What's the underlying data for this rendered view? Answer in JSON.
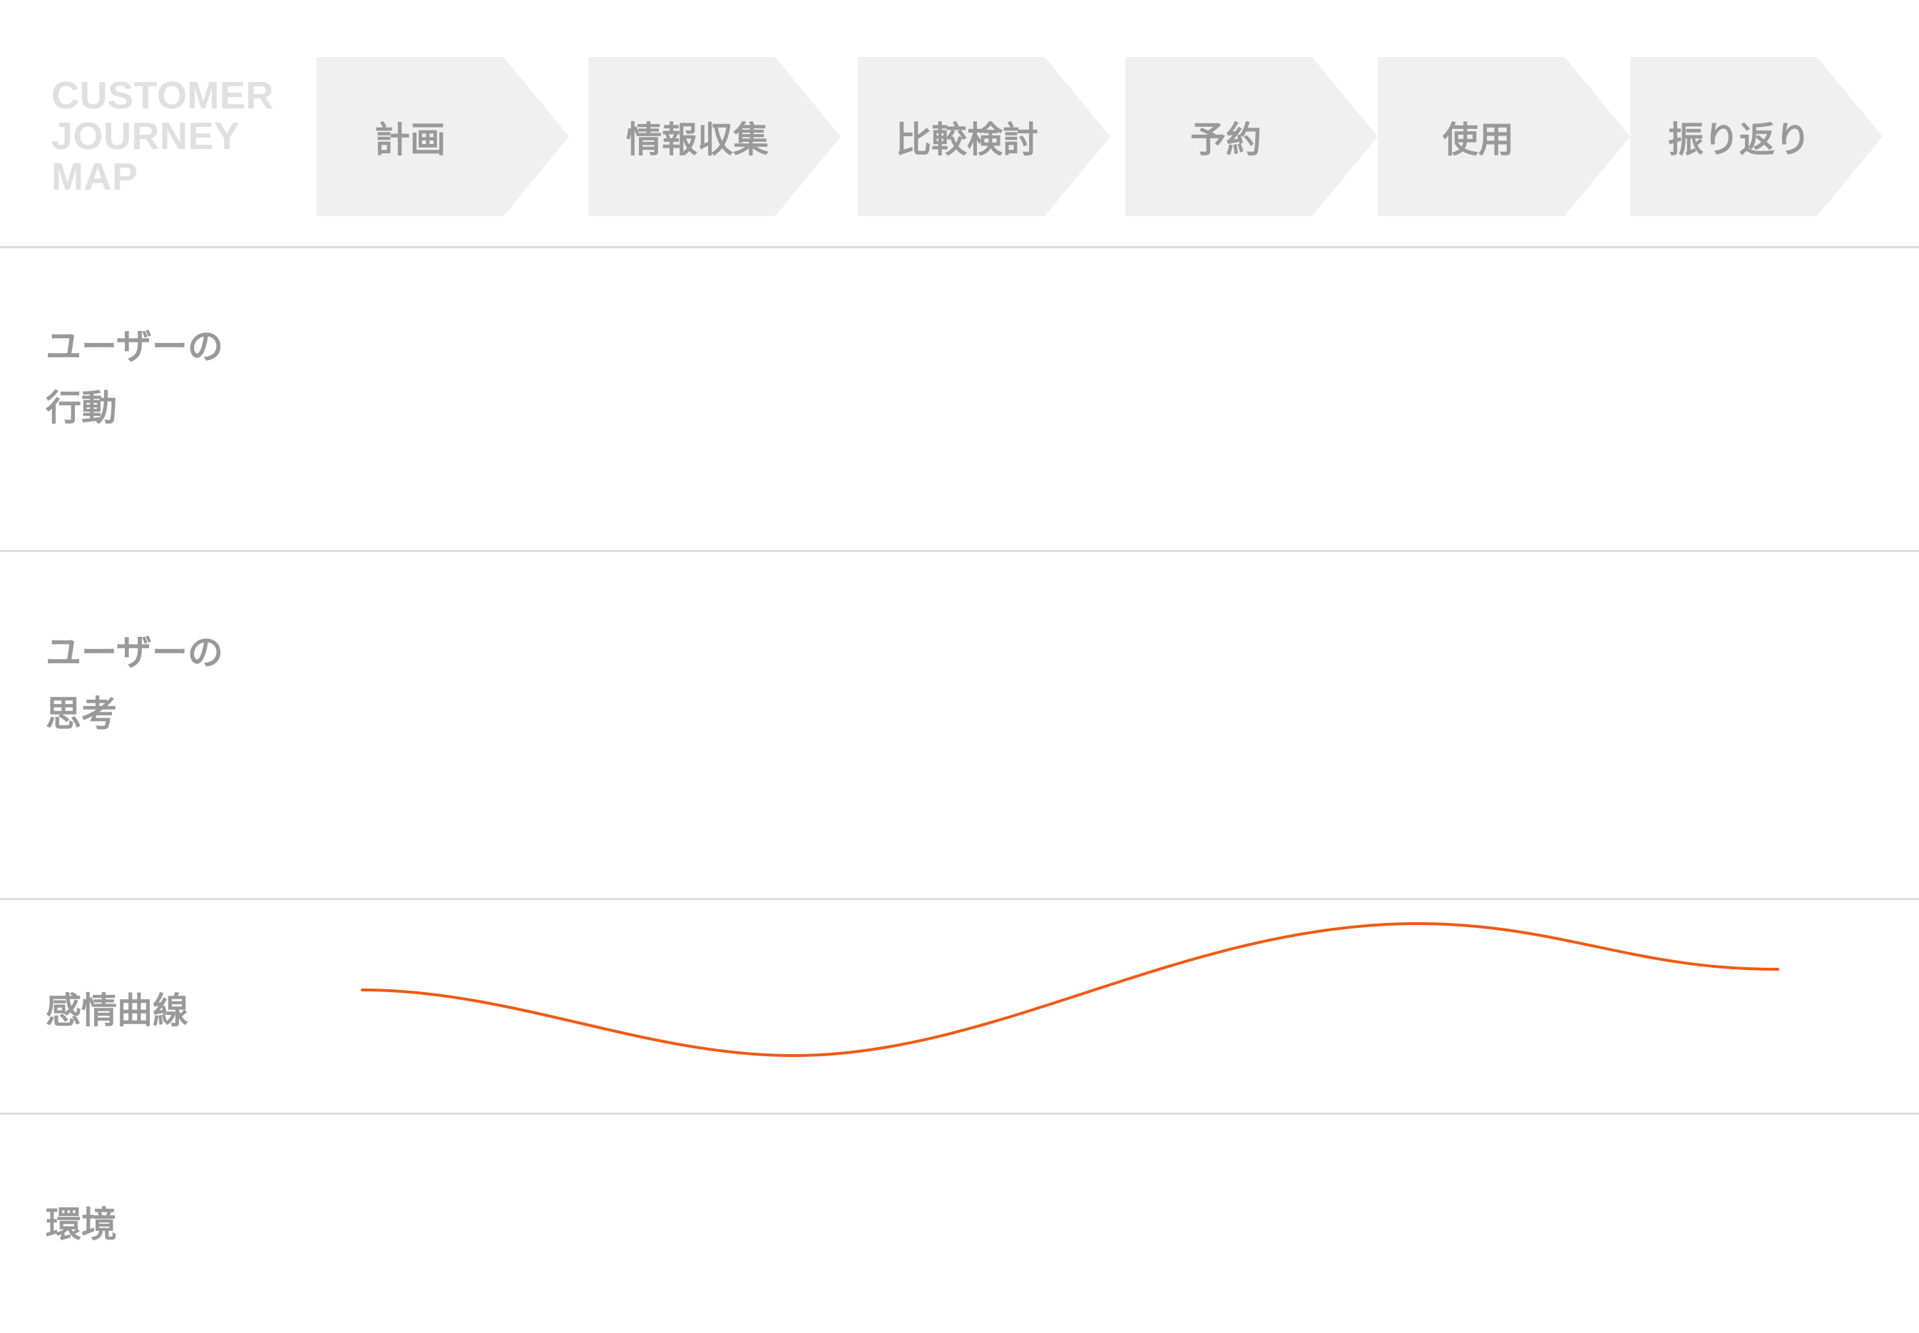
{
  "map_title": [
    "CUSTOMER",
    "JOURNEY",
    "MAP"
  ],
  "stages": [
    "計画",
    "情報収集",
    "比較検討",
    "予約",
    "使用",
    "振り返り"
  ],
  "rows": {
    "action": [
      "ユーザーの",
      "行動"
    ],
    "thought": [
      "ユーザーの",
      "思考"
    ],
    "emotion": [
      "感情曲線"
    ],
    "environment": [
      "環境"
    ]
  },
  "colors": {
    "stage_fill": "#f0f0f0",
    "label_text": "#999999",
    "title_text": "#e0e0e0",
    "divider": "#dddddd",
    "emotion_line": "#f05a14"
  }
}
